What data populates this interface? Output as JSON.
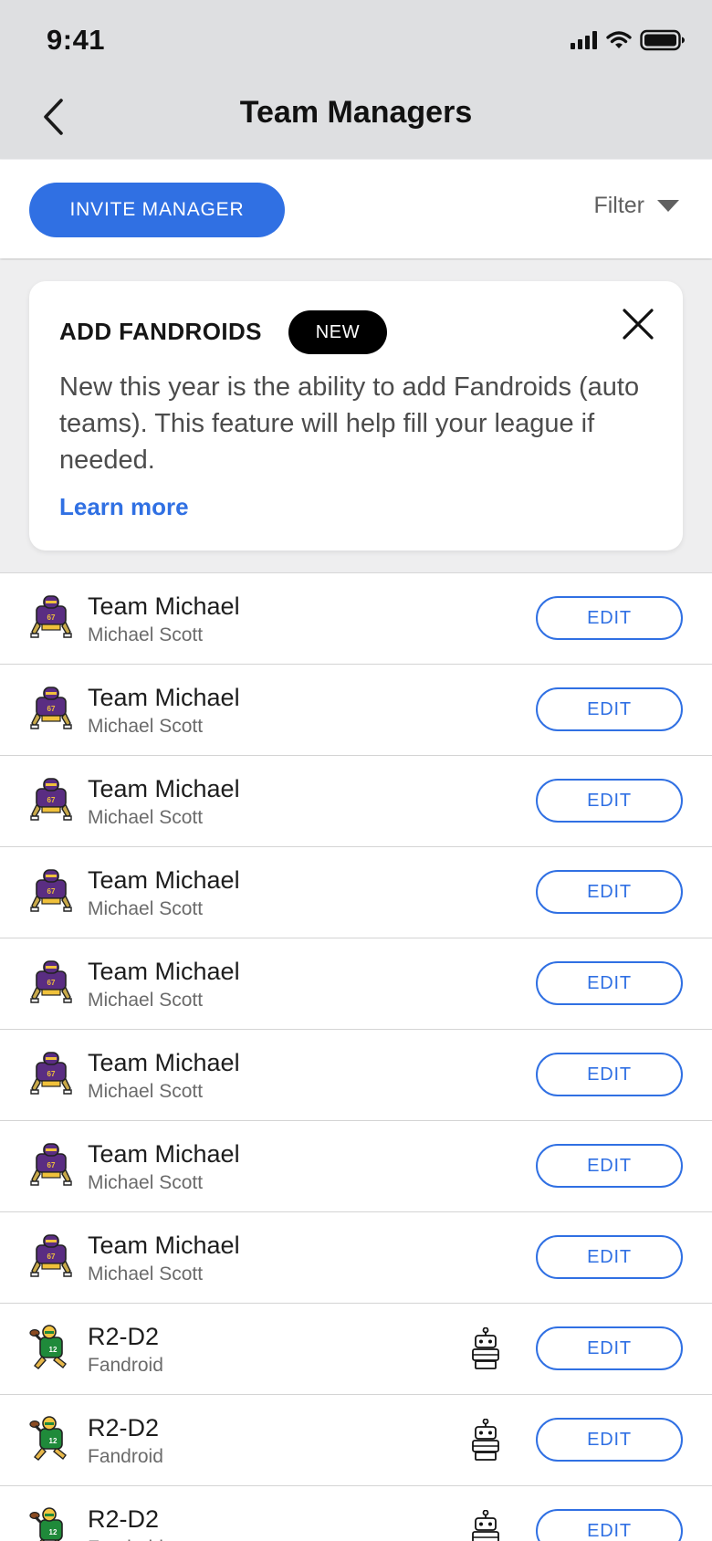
{
  "status_bar": {
    "time": "9:41",
    "icons": [
      "signal-bars-icon",
      "wifi-icon",
      "battery-icon"
    ]
  },
  "header": {
    "title": "Team Managers",
    "back_icon": "chevron-left-icon"
  },
  "actions": {
    "invite_label": "INVITE MANAGER",
    "filter_label": "Filter",
    "filter_icon": "caret-down-icon"
  },
  "promo": {
    "title": "ADD FANDROIDS",
    "badge": "NEW",
    "body": "New this year is the ability to add Fandroids (auto teams). This feature will help fill your league if needed.",
    "link": "Learn more",
    "close_icon": "close-icon"
  },
  "colors": {
    "accent": "#3070e3",
    "header_bg": "#dedfe1",
    "page_bg": "#eeeeef",
    "badge_bg": "#000000"
  },
  "teams": [
    {
      "team": "Team Michael",
      "manager": "Michael Scott",
      "avatar": "purple-lineman-avatar",
      "fandroid": false,
      "edit": "EDIT"
    },
    {
      "team": "Team Michael",
      "manager": "Michael Scott",
      "avatar": "purple-lineman-avatar",
      "fandroid": false,
      "edit": "EDIT"
    },
    {
      "team": "Team Michael",
      "manager": "Michael Scott",
      "avatar": "purple-lineman-avatar",
      "fandroid": false,
      "edit": "EDIT"
    },
    {
      "team": "Team Michael",
      "manager": "Michael Scott",
      "avatar": "purple-lineman-avatar",
      "fandroid": false,
      "edit": "EDIT"
    },
    {
      "team": "Team Michael",
      "manager": "Michael Scott",
      "avatar": "purple-lineman-avatar",
      "fandroid": false,
      "edit": "EDIT"
    },
    {
      "team": "Team Michael",
      "manager": "Michael Scott",
      "avatar": "purple-lineman-avatar",
      "fandroid": false,
      "edit": "EDIT"
    },
    {
      "team": "Team Michael",
      "manager": "Michael Scott",
      "avatar": "purple-lineman-avatar",
      "fandroid": false,
      "edit": "EDIT"
    },
    {
      "team": "Team Michael",
      "manager": "Michael Scott",
      "avatar": "purple-lineman-avatar",
      "fandroid": false,
      "edit": "EDIT"
    },
    {
      "team": "R2-D2",
      "manager": "Fandroid",
      "avatar": "green-quarterback-avatar",
      "fandroid": true,
      "robot_icon": "robot-icon",
      "edit": "EDIT"
    },
    {
      "team": "R2-D2",
      "manager": "Fandroid",
      "avatar": "green-quarterback-avatar",
      "fandroid": true,
      "robot_icon": "robot-icon",
      "edit": "EDIT"
    },
    {
      "team": "R2-D2",
      "manager": "Fandroid",
      "avatar": "green-quarterback-avatar",
      "fandroid": true,
      "robot_icon": "robot-icon",
      "edit": "EDIT"
    }
  ]
}
